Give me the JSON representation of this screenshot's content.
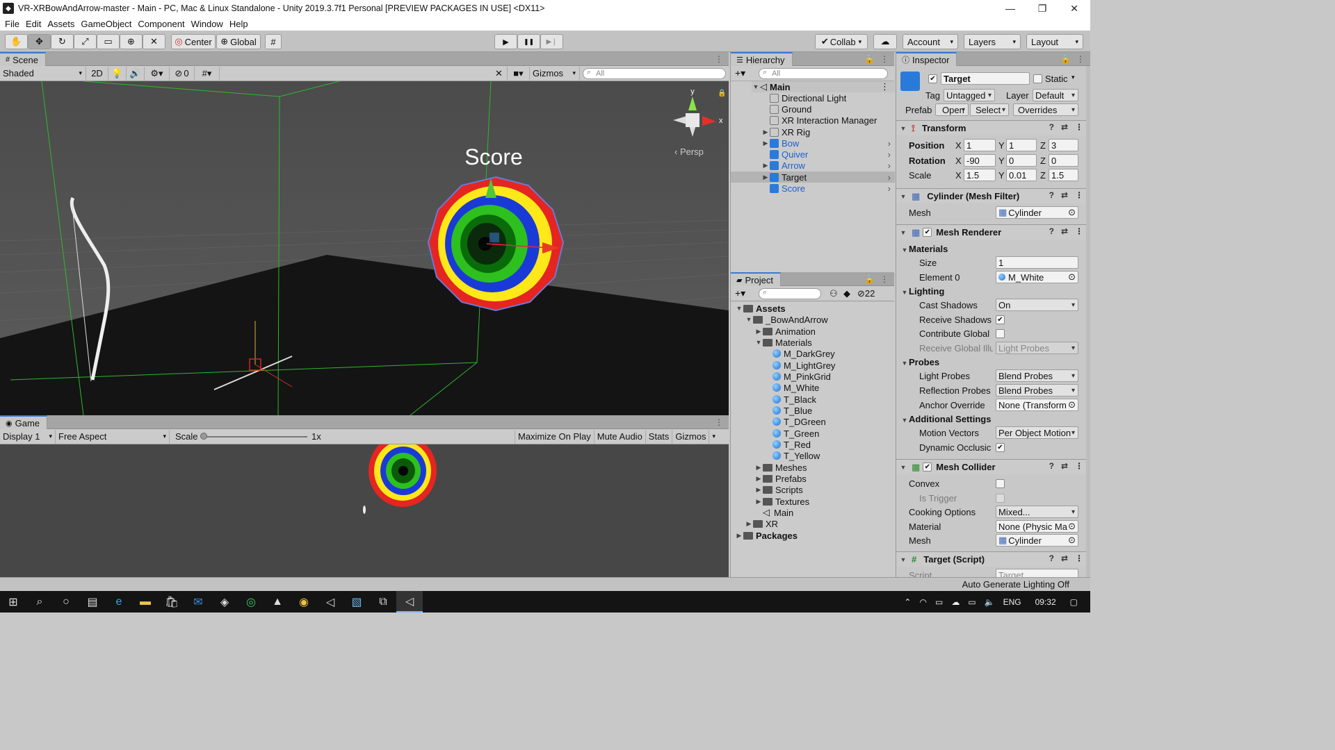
{
  "window": {
    "title": "VR-XRBowAndArrow-master - Main - PC, Mac & Linux Standalone - Unity 2019.3.7f1 Personal [PREVIEW PACKAGES IN USE] <DX11>",
    "minimize": "—",
    "maximize": "❐",
    "close": "✕"
  },
  "menu": [
    "File",
    "Edit",
    "Assets",
    "GameObject",
    "Component",
    "Window",
    "Help"
  ],
  "toolbar": {
    "center_label": "Center",
    "global_label": "Global",
    "collab_label": "Collab",
    "account_label": "Account",
    "layers_label": "Layers",
    "layout_label": "Layout",
    "play": "▶",
    "pause": "❚❚",
    "step": "▶❘"
  },
  "scene": {
    "tab_label": "Scene",
    "shading_mode": "Shaded",
    "mode_2d": "2D",
    "hidden_count": "0",
    "gizmos_label": "Gizmos",
    "search_placeholder": "All",
    "score_text": "Score",
    "persp_label": "Persp",
    "axis_y": "y",
    "axis_x": "x"
  },
  "game": {
    "tab_label": "Game",
    "display": "Display 1",
    "aspect": "Free Aspect",
    "scale_label": "Scale",
    "scale_value": "1x",
    "maximize_on_play": "Maximize On Play",
    "mute_audio": "Mute Audio",
    "stats": "Stats",
    "gizmos": "Gizmos"
  },
  "hierarchy": {
    "tab_label": "Hierarchy",
    "search_placeholder": "All",
    "scene_name": "Main",
    "items": [
      {
        "label": "Directional Light",
        "prefab": false
      },
      {
        "label": "Ground",
        "prefab": false
      },
      {
        "label": "XR Interaction Manager",
        "prefab": false
      },
      {
        "label": "XR Rig",
        "prefab": false
      },
      {
        "label": "Bow",
        "prefab": true
      },
      {
        "label": "Quiver",
        "prefab": true
      },
      {
        "label": "Arrow",
        "prefab": true
      },
      {
        "label": "Target",
        "prefab": true
      },
      {
        "label": "Score",
        "prefab": true
      }
    ]
  },
  "project": {
    "tab_label": "Project",
    "hidden_count": "22",
    "root": "Assets",
    "main_folder": "_BowAndArrow",
    "folders_top": [
      "Animation",
      "Materials"
    ],
    "materials": [
      "M_DarkGrey",
      "M_LightGrey",
      "M_PinkGrid",
      "M_White",
      "T_Black",
      "T_Blue",
      "T_DGreen",
      "T_Green",
      "T_Red",
      "T_Yellow"
    ],
    "folders_bottom": [
      "Meshes",
      "Prefabs",
      "Scripts",
      "Textures"
    ],
    "scene_asset": "Main",
    "xr_folder": "XR",
    "packages": "Packages"
  },
  "inspector": {
    "tab_label": "Inspector",
    "object_name": "Target",
    "static_label": "Static",
    "tag_label": "Tag",
    "tag_value": "Untagged",
    "layer_label": "Layer",
    "layer_value": "Default",
    "prefab_label": "Prefab",
    "open_label": "Open",
    "select_label": "Select",
    "overrides_label": "Overrides",
    "transform": {
      "title": "Transform",
      "position_label": "Position",
      "rotation_label": "Rotation",
      "scale_label": "Scale",
      "position": {
        "x": "1",
        "y": "1",
        "z": "3"
      },
      "rotation": {
        "x": "-90",
        "y": "0",
        "z": "0"
      },
      "scale": {
        "x": "1.5",
        "y": "0.01",
        "z": "1.5"
      }
    },
    "mesh_filter": {
      "title": "Cylinder (Mesh Filter)",
      "mesh_label": "Mesh",
      "mesh_value": "Cylinder"
    },
    "mesh_renderer": {
      "title": "Mesh Renderer",
      "materials_label": "Materials",
      "size_label": "Size",
      "size_value": "1",
      "element0_label": "Element 0",
      "element0_value": "M_White",
      "lighting_label": "Lighting",
      "cast_shadows_label": "Cast Shadows",
      "cast_shadows_value": "On",
      "receive_shadows_label": "Receive Shadows",
      "contribute_global_label": "Contribute Global",
      "receive_global_label": "Receive Global Illu",
      "receive_global_value": "Light Probes",
      "probes_label": "Probes",
      "light_probes_label": "Light Probes",
      "light_probes_value": "Blend Probes",
      "reflection_probes_label": "Reflection Probes",
      "reflection_probes_value": "Blend Probes",
      "anchor_override_label": "Anchor Override",
      "anchor_override_value": "None (Transform",
      "additional_label": "Additional Settings",
      "motion_vectors_label": "Motion Vectors",
      "motion_vectors_value": "Per Object Motion",
      "dynamic_occlusion_label": "Dynamic Occlusic"
    },
    "mesh_collider": {
      "title": "Mesh Collider",
      "convex_label": "Convex",
      "is_trigger_label": "Is Trigger",
      "cooking_label": "Cooking Options",
      "cooking_value": "Mixed...",
      "material_label": "Material",
      "material_value": "None (Physic Ma",
      "mesh_label": "Mesh",
      "mesh_value": "Cylinder"
    },
    "target_script": {
      "title": "Target (Script)",
      "script_label": "Script",
      "script_value": "Target"
    }
  },
  "status": {
    "lighting": "Auto Generate Lighting Off"
  },
  "taskbar": {
    "lang": "ENG",
    "time": "09:32"
  }
}
